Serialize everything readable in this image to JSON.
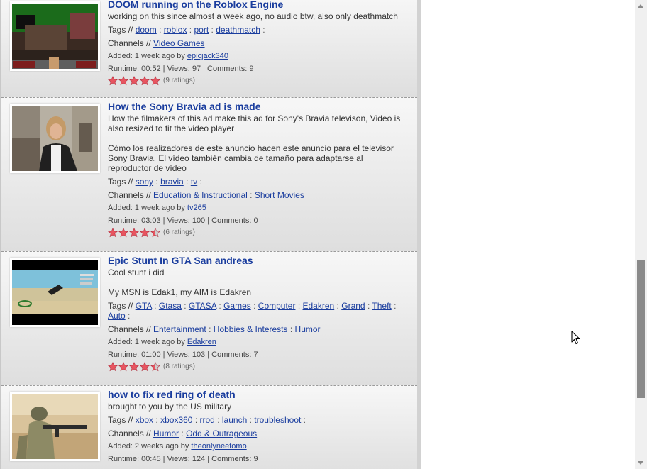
{
  "videos": [
    {
      "title": "DOOM running on the Roblox Engine",
      "desc": [
        "working on this since almost a week ago, no audio btw, also only deathmatch"
      ],
      "tags_label": "Tags //",
      "tags": [
        "doom",
        "roblox",
        "port",
        "deathmatch"
      ],
      "channels_label": "Channels //",
      "channels": [
        "Video Games"
      ],
      "added": "Added: 1 week ago by",
      "user": "epicjack340",
      "runtime": "Runtime: 00:52 | Views: 97 | Comments: 9",
      "rating": 5,
      "ratings": "(9 ratings)"
    },
    {
      "title": "How the Sony Bravia ad is made",
      "desc": [
        "How the filmakers of this ad make this ad for Sony's Bravia televison, Video is also resized to fit the video player",
        "Cómo los realizadores de este anuncio hacen este anuncio para el televisor Sony Bravia, El vídeo también cambia de tamaño para adaptarse al reproductor de vídeo"
      ],
      "tags_label": "Tags //",
      "tags": [
        "sony",
        "bravia",
        "tv"
      ],
      "channels_label": "Channels //",
      "channels": [
        "Education & Instructional",
        "Short Movies"
      ],
      "added": "Added: 1 week ago by",
      "user": "tv265",
      "runtime": "Runtime: 03:03 | Views: 100 | Comments: 0",
      "rating": 4.5,
      "ratings": "(6 ratings)"
    },
    {
      "title": "Epic Stunt In GTA San andreas",
      "desc": [
        "Cool stunt i did",
        "My MSN is Edak1, my AIM is Edakren"
      ],
      "tags_label": "Tags //",
      "tags": [
        "GTA",
        "Gtasa",
        "GTASA",
        "Games",
        "Computer",
        "Edakren",
        "Grand",
        "Theft",
        "Auto"
      ],
      "channels_label": "Channels //",
      "channels": [
        "Entertainment",
        "Hobbies & Interests",
        "Humor"
      ],
      "added": "Added: 1 week ago by",
      "user": "Edakren",
      "runtime": "Runtime: 01:00 | Views: 103 | Comments: 7",
      "rating": 4.5,
      "ratings": "(8 ratings)"
    },
    {
      "title": "how to fix red ring of death",
      "desc": [
        "brought to you by the US military"
      ],
      "tags_label": "Tags //",
      "tags": [
        "xbox",
        "xbox360",
        "rrod",
        "launch",
        "troubleshoot"
      ],
      "channels_label": "Channels //",
      "channels": [
        "Humor",
        "Odd & Outrageous"
      ],
      "added": "Added: 2 weeks ago by",
      "user": "theonlyneetomo",
      "runtime": "Runtime: 00:45 | Views: 124 | Comments: 9",
      "rating": null,
      "ratings": ""
    }
  ],
  "colors": {
    "link": "#1a3d9e",
    "star": "#e85560",
    "star_empty": "#cfcfcf"
  }
}
